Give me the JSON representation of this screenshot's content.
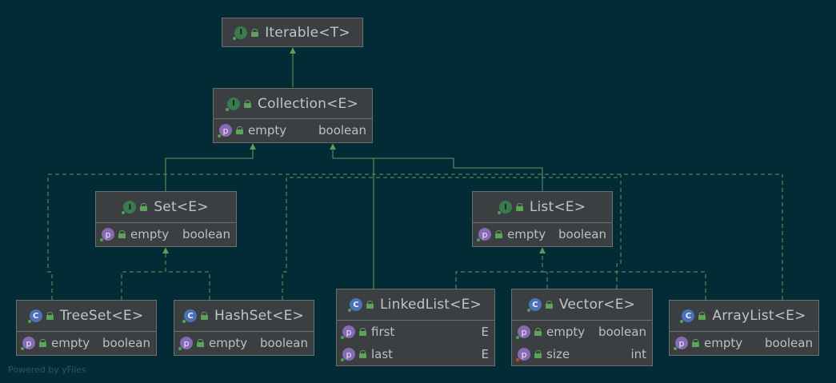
{
  "watermark": "Powered by yFiles",
  "colors": {
    "background": "#022b36",
    "node": "#3c3f41",
    "border": "#6d6e6e",
    "edge": "#5f9e5a"
  },
  "nodes": {
    "iterable": {
      "kind": "interface",
      "badge": "I",
      "title": "Iterable<T>",
      "fields": []
    },
    "collection": {
      "kind": "interface",
      "badge": "I",
      "title": "Collection<E>",
      "fields": [
        {
          "icon": "p",
          "name": "empty",
          "type": "boolean"
        }
      ]
    },
    "set": {
      "kind": "interface",
      "badge": "I",
      "title": "Set<E>",
      "fields": [
        {
          "icon": "p",
          "name": "empty",
          "type": "boolean"
        }
      ]
    },
    "list": {
      "kind": "interface",
      "badge": "I",
      "title": "List<E>",
      "fields": [
        {
          "icon": "p",
          "name": "empty",
          "type": "boolean"
        }
      ]
    },
    "treeset": {
      "kind": "class",
      "badge": "C",
      "title": "TreeSet<E>",
      "fields": [
        {
          "icon": "p",
          "name": "empty",
          "type": "boolean"
        }
      ]
    },
    "hashset": {
      "kind": "class",
      "badge": "C",
      "title": "HashSet<E>",
      "fields": [
        {
          "icon": "p",
          "name": "empty",
          "type": "boolean"
        }
      ]
    },
    "linkedlist": {
      "kind": "class",
      "badge": "C",
      "title": "LinkedList<E>",
      "fields": [
        {
          "icon": "p",
          "name": "first",
          "type": "E"
        },
        {
          "icon": "p",
          "name": "last",
          "type": "E"
        }
      ]
    },
    "vector": {
      "kind": "class",
      "badge": "C",
      "title": "Vector<E>",
      "fields": [
        {
          "icon": "p",
          "name": "empty",
          "type": "boolean"
        },
        {
          "icon": "p",
          "name": "size",
          "type": "int"
        }
      ]
    },
    "arraylist": {
      "kind": "class",
      "badge": "C",
      "title": "ArrayList<E>",
      "fields": [
        {
          "icon": "p",
          "name": "empty",
          "type": "boolean"
        }
      ]
    }
  },
  "edges": [
    {
      "from": "collection",
      "to": "iterable",
      "style": "solid"
    },
    {
      "from": "set",
      "to": "collection",
      "style": "solid"
    },
    {
      "from": "list",
      "to": "collection",
      "style": "solid"
    },
    {
      "from": "linkedlist",
      "to": "collection",
      "style": "solid"
    },
    {
      "from": "treeset",
      "to": "set",
      "style": "dashed"
    },
    {
      "from": "hashset",
      "to": "set",
      "style": "dashed"
    },
    {
      "from": "linkedlist",
      "to": "list",
      "style": "dashed"
    },
    {
      "from": "vector",
      "to": "list",
      "style": "dashed"
    },
    {
      "from": "arraylist",
      "to": "list",
      "style": "dashed"
    },
    {
      "from": "treeset",
      "to": "collection",
      "style": "dashed"
    },
    {
      "from": "hashset",
      "to": "collection",
      "style": "dashed"
    },
    {
      "from": "vector",
      "to": "collection",
      "style": "dashed"
    },
    {
      "from": "arraylist",
      "to": "collection",
      "style": "dashed"
    }
  ]
}
